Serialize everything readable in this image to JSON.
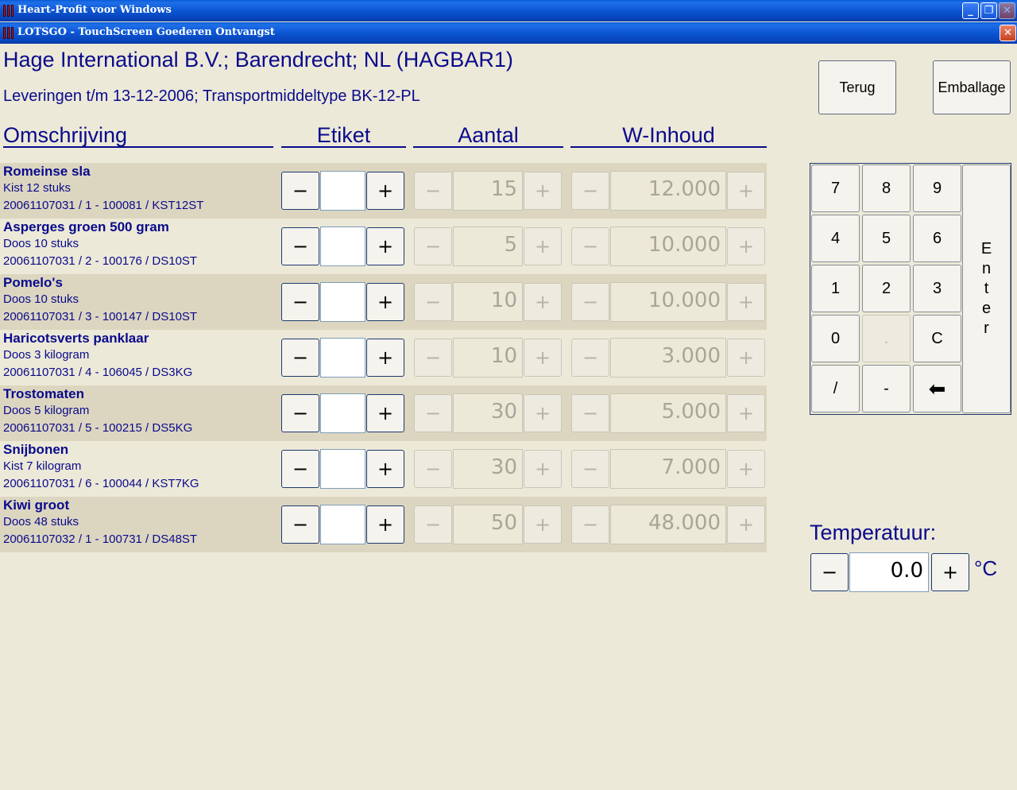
{
  "outer_window": {
    "title": "Heart-Profit voor Windows"
  },
  "inner_window": {
    "title": "LOTSGO - TouchScreen Goederen Ontvangst"
  },
  "header": {
    "company": "Hage International B.V.; Barendrecht; NL (HAGBAR1)",
    "deliveries": "Leveringen t/m 13-12-2006; Transportmiddeltype BK-12-PL"
  },
  "columns": {
    "description": "Omschrijving",
    "label": "Etiket",
    "quantity": "Aantal",
    "content": "W-Inhoud"
  },
  "actions": {
    "back": "Terug",
    "packaging": "Emballage"
  },
  "controls": {
    "minus": "−",
    "plus": "+"
  },
  "rows": [
    {
      "name": "Romeinse sla",
      "pack": "Kist 12 stuks",
      "code": "20061107031 / 1 - 100081 / KST12ST",
      "label": "",
      "quantity": "15",
      "content": "12.000"
    },
    {
      "name": "Asperges groen 500 gram",
      "pack": "Doos 10 stuks",
      "code": "20061107031 / 2 - 100176 / DS10ST",
      "label": "",
      "quantity": "5",
      "content": "10.000"
    },
    {
      "name": "Pomelo's",
      "pack": "Doos 10 stuks",
      "code": "20061107031 / 3 - 100147 / DS10ST",
      "label": "",
      "quantity": "10",
      "content": "10.000"
    },
    {
      "name": "Haricotsverts panklaar",
      "pack": "Doos 3 kilogram",
      "code": "20061107031 / 4 - 106045 / DS3KG",
      "label": "",
      "quantity": "10",
      "content": "3.000"
    },
    {
      "name": "Trostomaten",
      "pack": "Doos 5 kilogram",
      "code": "20061107031 / 5 - 100215 / DS5KG",
      "label": "",
      "quantity": "30",
      "content": "5.000"
    },
    {
      "name": "Snijbonen",
      "pack": "Kist 7 kilogram",
      "code": "20061107031 / 6 - 100044 / KST7KG",
      "label": "",
      "quantity": "30",
      "content": "7.000"
    },
    {
      "name": "Kiwi groot",
      "pack": "Doos 48 stuks",
      "code": "20061107032 / 1 - 100731 / DS48ST",
      "label": "",
      "quantity": "50",
      "content": "48.000"
    }
  ],
  "keypad": {
    "keys": [
      "7",
      "8",
      "9",
      "4",
      "5",
      "6",
      "1",
      "2",
      "3",
      "0",
      ".",
      "C",
      "/",
      "-",
      "⬅"
    ],
    "enter": [
      "E",
      "n",
      "t",
      "e",
      "r"
    ]
  },
  "temperature": {
    "label": "Temperatuur:",
    "value": "0.0",
    "unit": "°C"
  }
}
